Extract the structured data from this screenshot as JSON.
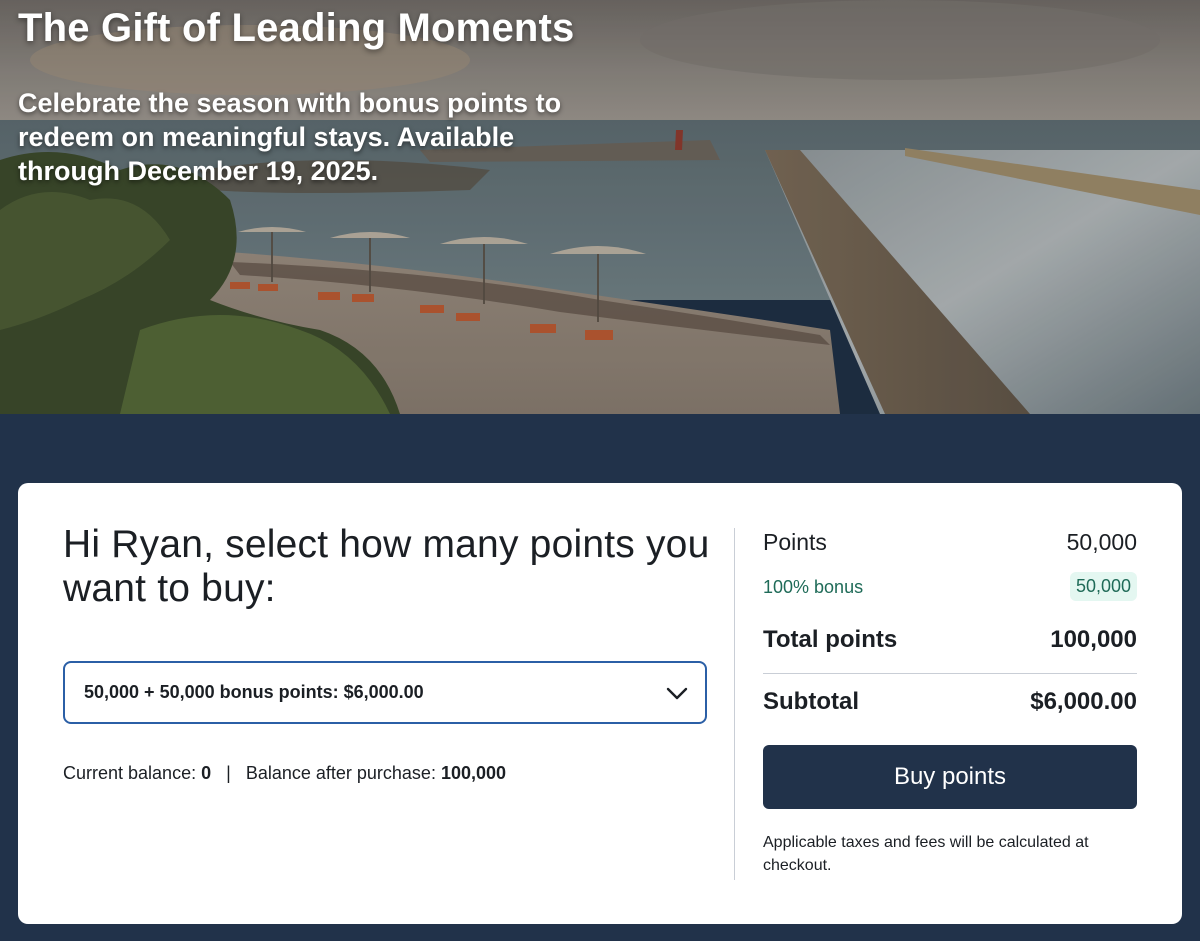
{
  "hero": {
    "title": "The Gift of Leading Moments",
    "subtitle": "Celebrate the season with bonus points to redeem on meaningful stays. Available through December 19, 2025."
  },
  "purchase": {
    "heading": "Hi Ryan, select how many points you want to buy:",
    "selected_option": "50,000 + 50,000 bonus points: $6,000.00",
    "current_balance_label": "Current balance:",
    "current_balance_value": "0",
    "separator": "|",
    "after_purchase_label": "Balance after purchase:",
    "after_purchase_value": "100,000"
  },
  "summary": {
    "points_label": "Points",
    "points_value": "50,000",
    "bonus_label": "100% bonus",
    "bonus_value": "50,000",
    "total_label": "Total points",
    "total_value": "100,000",
    "subtotal_label": "Subtotal",
    "subtotal_value": "$6,000.00",
    "buy_button": "Buy points",
    "note": "Applicable taxes and fees will be calculated at checkout."
  },
  "colors": {
    "navy": "#21324a",
    "select_border": "#2b5fa6",
    "bonus_text": "#1f6b58",
    "bonus_pill": "#e4f7f1"
  },
  "icons": {
    "select_chevron": "chevron-down-icon"
  }
}
